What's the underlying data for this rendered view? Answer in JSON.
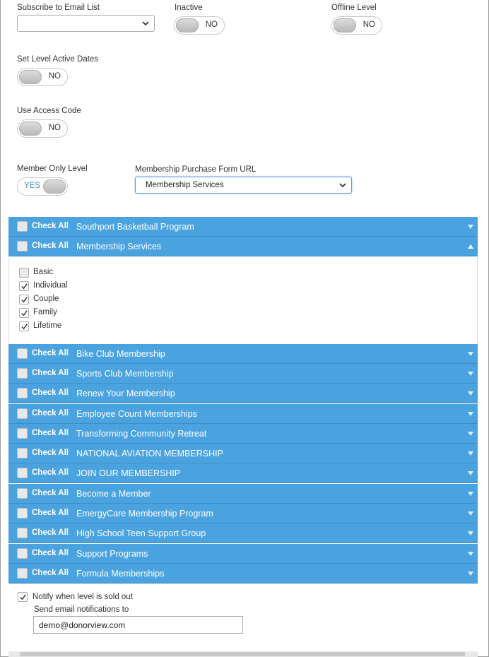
{
  "fields": {
    "subscribe_label": "Subscribe to Email List",
    "subscribe_value": "",
    "inactive_label": "Inactive",
    "inactive_toggle": "NO",
    "offline_label": "Offline Level",
    "offline_toggle": "NO",
    "active_dates_label": "Set Level Active Dates",
    "active_dates_toggle": "NO",
    "access_code_label": "Use Access Code",
    "access_code_toggle": "NO",
    "member_only_label": "Member Only Level",
    "member_only_toggle": "YES",
    "purchase_url_label": "Membership Purchase Form URL",
    "purchase_url_value": "Membership Services"
  },
  "check_all_label": "Check All",
  "accordion": [
    {
      "title": "Southport Basketball Program",
      "expanded": false
    },
    {
      "title": "Membership Services",
      "expanded": true
    },
    {
      "title": "Bike Club Membership",
      "expanded": false
    },
    {
      "title": "Sports Club Membership",
      "expanded": false
    },
    {
      "title": "Renew Your Membership",
      "expanded": false
    },
    {
      "title": "Employee Count Memberships",
      "expanded": false
    },
    {
      "title": "Transforming Community Retreat",
      "expanded": false
    },
    {
      "title": "NATIONAL AVIATION MEMBERSHIP",
      "expanded": false
    },
    {
      "title": "JOIN OUR MEMBERSHIP",
      "expanded": false
    },
    {
      "title": "Become a Member",
      "expanded": false
    },
    {
      "title": "EmergyCare Membership Program",
      "expanded": false
    },
    {
      "title": "High School Teen Support Group",
      "expanded": false
    },
    {
      "title": "Support Programs",
      "expanded": false
    },
    {
      "title": "Formula Memberships",
      "expanded": false
    }
  ],
  "expanded_items": [
    {
      "label": "Basic",
      "checked": false
    },
    {
      "label": "Individual",
      "checked": true
    },
    {
      "label": "Couple",
      "checked": true
    },
    {
      "label": "Family",
      "checked": true
    },
    {
      "label": "Lifetime",
      "checked": true
    }
  ],
  "notify": {
    "label": "Notify when level is sold out",
    "checked": true,
    "send_to_label": "Send email notifications to",
    "email": "demo@donorview.com"
  },
  "colors": {
    "accordion_bg": "#4aa3df",
    "toggle_on_text": "#3a8fd6"
  }
}
